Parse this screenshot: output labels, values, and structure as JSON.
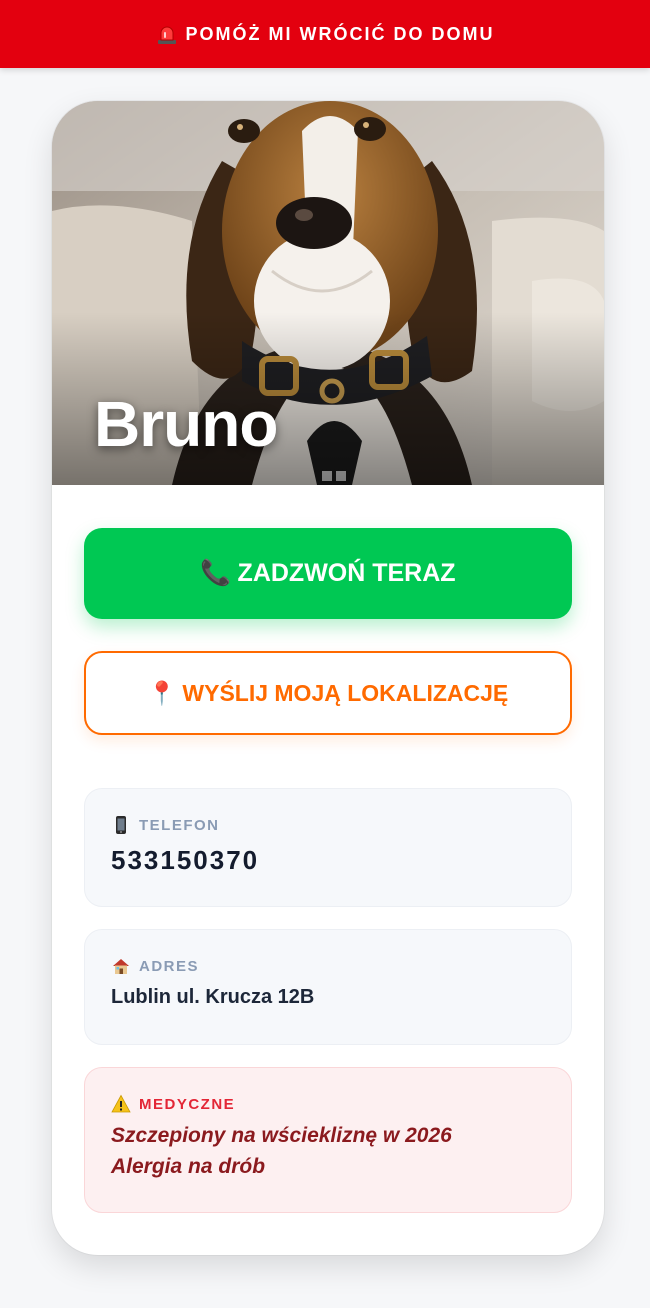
{
  "banner": {
    "text": "POMÓŻ MI WRÓCIĆ DO DOMU",
    "icon": "siren-icon",
    "color": "#e3000f"
  },
  "pet": {
    "name": "Bruno",
    "photo_icon": "dog-photo"
  },
  "actions": {
    "call_label": "ZADZWOŃ TERAZ",
    "call_icon": "📞",
    "call_color": "#00c853",
    "location_label": "WYŚLIJ MOJĄ LOKALIZACJĘ",
    "location_icon": "📍",
    "location_color": "#ff6a00"
  },
  "phone": {
    "icon": "mobile-phone-icon",
    "label": "TELEFON",
    "value": "533150370"
  },
  "address": {
    "icon": "house-icon",
    "label": "ADRES",
    "value": "Lublin ul. Krucza 12B"
  },
  "medical": {
    "icon": "warning-icon",
    "label": "MEDYCZNE",
    "lines": [
      "Szczepiony na wściekliznę w 2026",
      "Alergia na drób"
    ],
    "color": "#e32636"
  }
}
